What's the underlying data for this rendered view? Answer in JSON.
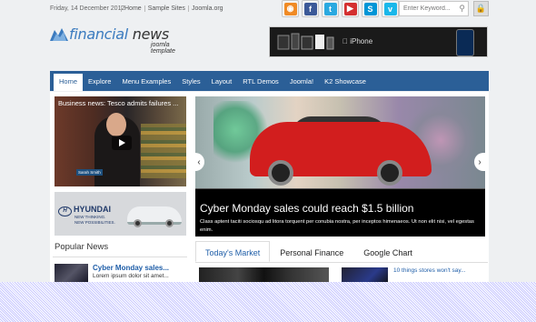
{
  "topbar": {
    "date": "Friday, 14 December 2012",
    "links": [
      "Home",
      "Sample Sites",
      "Joomla.org"
    ]
  },
  "social": [
    {
      "icon": "rss-icon",
      "glyph": "◉",
      "color": "#f08a24"
    },
    {
      "icon": "facebook-icon",
      "glyph": "f",
      "color": "#3b5998"
    },
    {
      "icon": "twitter-icon",
      "glyph": "t",
      "color": "#2aa9e0"
    },
    {
      "icon": "youtube-icon",
      "glyph": "▶",
      "color": "#d42f2f"
    },
    {
      "icon": "skype-icon",
      "glyph": "S",
      "color": "#0095d6"
    },
    {
      "icon": "vimeo-icon",
      "glyph": "v",
      "color": "#1ab7ea"
    }
  ],
  "search": {
    "placeholder": "Enter Keyword..."
  },
  "logo": {
    "name_accent": "financial",
    "name_rest": " news",
    "sub": "joomla template"
  },
  "ad": {
    "brand": "iPhone"
  },
  "nav": [
    "Home",
    "Explore",
    "Menu Examples",
    "Styles",
    "Layout",
    "RTL Demos",
    "Joomla!",
    "K2 Showcase"
  ],
  "video": {
    "title": "Business news: Tesco admits failures ...",
    "caption": "Sarah Smith"
  },
  "hyundai": {
    "brand": "HYUNDAI",
    "tagline1": "NEW THINKING.",
    "tagline2": "NEW POSSIBILITIES."
  },
  "slider": {
    "headline": "Cyber Monday sales could reach $1.5 billion",
    "desc": "Class aptent taciti sociosqu ad litora torquent per conubia nostra, per inceptos himenaeos. Ut non elit nisi, vel egestas enim."
  },
  "popular": {
    "heading": "Popular News",
    "item_title": "Cyber Monday sales...",
    "item_text": "Lorem ipsum dolor sit amet..."
  },
  "tabs": [
    "Today's Market",
    "Personal Finance",
    "Google Chart"
  ],
  "stories": "10 things stores won't say..."
}
